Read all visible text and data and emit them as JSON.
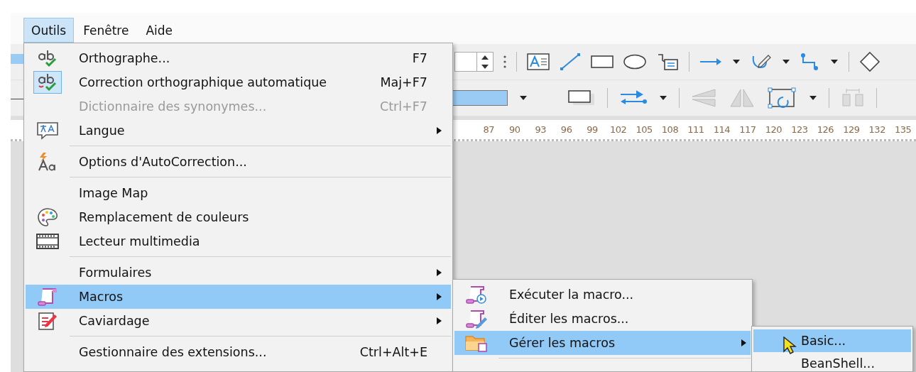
{
  "menubar": [
    {
      "label": "Outils",
      "selected": true
    },
    {
      "label": "Fenêtre",
      "selected": false
    },
    {
      "label": "Aide",
      "selected": false
    }
  ],
  "ruler": {
    "labels": [
      "87",
      "90",
      "93",
      "96",
      "99",
      "102",
      "105",
      "108",
      "111",
      "114",
      "117",
      "120",
      "123",
      "126",
      "129",
      "132",
      "135"
    ]
  },
  "menu": {
    "items": [
      {
        "kind": "item",
        "label": "Orthographe...",
        "shortcut": "F7",
        "checked": false,
        "disabled": false,
        "selected": false,
        "submenu": false
      },
      {
        "kind": "item",
        "label": "Correction orthographique automatique",
        "shortcut": "Maj+F7",
        "checked": true,
        "disabled": false,
        "selected": false,
        "submenu": false
      },
      {
        "kind": "item",
        "label": "Dictionnaire des synonymes...",
        "shortcut": "Ctrl+F7",
        "checked": false,
        "disabled": true,
        "selected": false,
        "submenu": false
      },
      {
        "kind": "item",
        "label": "Langue",
        "checked": false,
        "disabled": false,
        "selected": false,
        "submenu": true
      },
      {
        "kind": "separator"
      },
      {
        "kind": "item",
        "label": "Options d'AutoCorrection...",
        "checked": false,
        "disabled": false,
        "selected": false,
        "submenu": false
      },
      {
        "kind": "separator"
      },
      {
        "kind": "item",
        "label": "Image Map",
        "checked": false,
        "disabled": false,
        "selected": false,
        "submenu": false
      },
      {
        "kind": "item",
        "label": "Remplacement de couleurs",
        "checked": false,
        "disabled": false,
        "selected": false,
        "submenu": false
      },
      {
        "kind": "item",
        "label": "Lecteur multimedia",
        "checked": false,
        "disabled": false,
        "selected": false,
        "submenu": false
      },
      {
        "kind": "separator"
      },
      {
        "kind": "item",
        "label": "Formulaires",
        "checked": false,
        "disabled": false,
        "selected": false,
        "submenu": true
      },
      {
        "kind": "item",
        "label": "Macros",
        "checked": false,
        "disabled": false,
        "selected": true,
        "submenu": true
      },
      {
        "kind": "item",
        "label": "Caviardage",
        "checked": false,
        "disabled": false,
        "selected": false,
        "submenu": true
      },
      {
        "kind": "separator"
      },
      {
        "kind": "item",
        "label": "Gestionnaire des extensions...",
        "shortcut": "Ctrl+Alt+E",
        "checked": false,
        "disabled": false,
        "selected": false,
        "submenu": false
      }
    ]
  },
  "macros_menu": {
    "items": [
      {
        "kind": "item",
        "label": "Exécuter la macro...",
        "checked": false,
        "disabled": false,
        "selected": false,
        "submenu": false
      },
      {
        "kind": "item",
        "label": "Éditer les macros...",
        "checked": false,
        "disabled": false,
        "selected": false,
        "submenu": false
      },
      {
        "kind": "item",
        "label": "Gérer les macros",
        "checked": false,
        "disabled": false,
        "selected": true,
        "submenu": true
      },
      {
        "kind": "separator"
      }
    ]
  },
  "manage_menu": {
    "items": [
      {
        "kind": "item",
        "label": "Basic...",
        "checked": false,
        "disabled": false,
        "selected": true,
        "submenu": false
      },
      {
        "kind": "item",
        "label": "BeanShell...",
        "checked": false,
        "disabled": false,
        "selected": false,
        "submenu": false
      }
    ]
  }
}
